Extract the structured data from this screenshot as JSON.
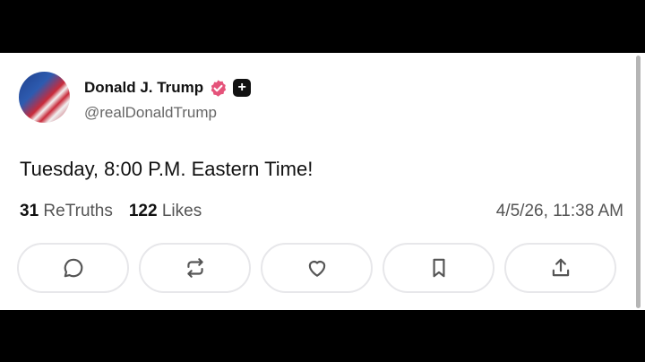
{
  "post": {
    "author_name": "Donald J. Trump",
    "handle": "@realDonaldTrump",
    "text": "Tuesday, 8:00 P.M. Eastern Time!",
    "retruths_count": "31",
    "retruths_label": "ReTruths",
    "likes_count": "122",
    "likes_label": "Likes",
    "timestamp": "4/5/26, 11:38 AM"
  },
  "badges": {
    "verified_color": "#e5537a",
    "plus_glyph": "+"
  },
  "actions": [
    "reply-icon",
    "retruth-icon",
    "like-icon",
    "bookmark-icon",
    "share-icon"
  ]
}
